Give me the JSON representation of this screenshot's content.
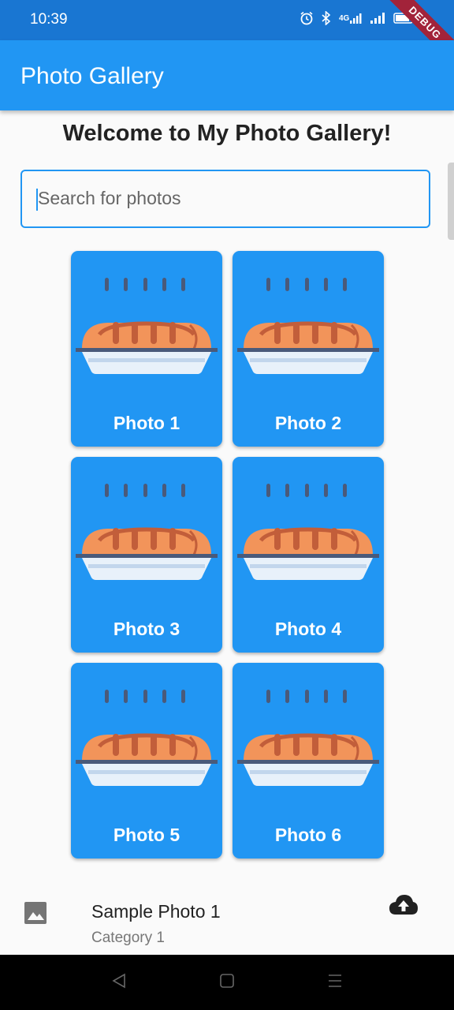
{
  "status_bar": {
    "time": "10:39",
    "network": "4G"
  },
  "debug_banner": "DEBUG",
  "app_bar": {
    "title": "Photo Gallery"
  },
  "welcome": "Welcome to My Photo Gallery!",
  "search": {
    "placeholder": "Search for photos",
    "value": ""
  },
  "photos": [
    {
      "label": "Photo 1"
    },
    {
      "label": "Photo 2"
    },
    {
      "label": "Photo 3"
    },
    {
      "label": "Photo 4"
    },
    {
      "label": "Photo 5"
    },
    {
      "label": "Photo 6"
    }
  ],
  "list_items": [
    {
      "title": "Sample Photo 1",
      "subtitle": "Category 1",
      "leading_icon": "image-icon",
      "trailing_icon": "cloud-upload-icon"
    }
  ],
  "nav_bar": {
    "icons": [
      "back-icon",
      "home-icon",
      "menu-icon"
    ]
  },
  "colors": {
    "primary": "#2196f3",
    "status_bar": "#1976d2",
    "banner": "#a2233a"
  }
}
